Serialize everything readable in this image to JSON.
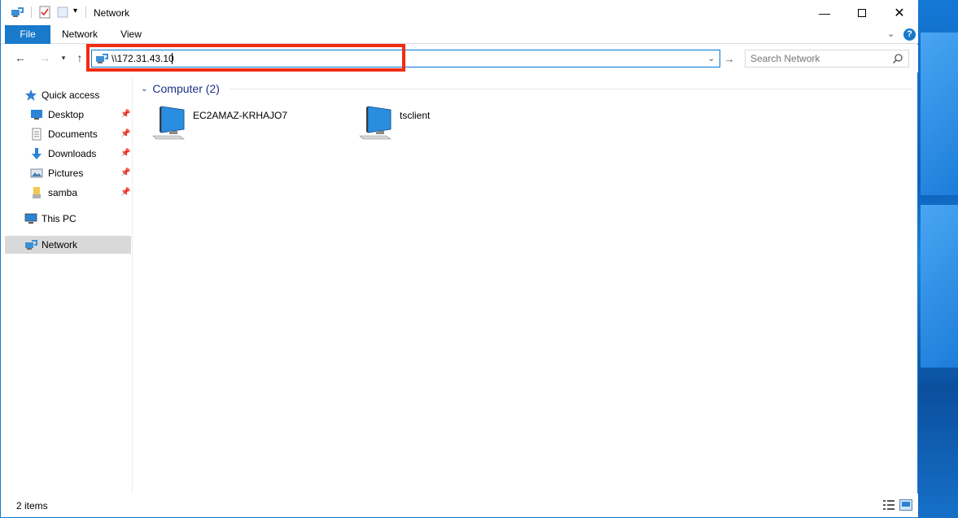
{
  "window": {
    "title": "Network"
  },
  "ribbon": {
    "tabs": [
      {
        "label": "File"
      },
      {
        "label": "Network"
      },
      {
        "label": "View"
      }
    ]
  },
  "address": {
    "value": "\\\\172.31.43.10"
  },
  "search": {
    "placeholder": "Search Network"
  },
  "nav": {
    "quick_access": "Quick access",
    "desktop": "Desktop",
    "documents": "Documents",
    "downloads": "Downloads",
    "pictures": "Pictures",
    "samba": "samba",
    "this_pc": "This PC",
    "network": "Network"
  },
  "content": {
    "group_label": "Computer (2)",
    "computers": [
      {
        "name": "EC2AMAZ-KRHAJO7"
      },
      {
        "name": "tsclient"
      }
    ]
  },
  "status": {
    "count": "2 items"
  },
  "colors": {
    "accent": "#1979ca",
    "highlight_box": "#f12b12",
    "group_header": "#1e3287"
  }
}
